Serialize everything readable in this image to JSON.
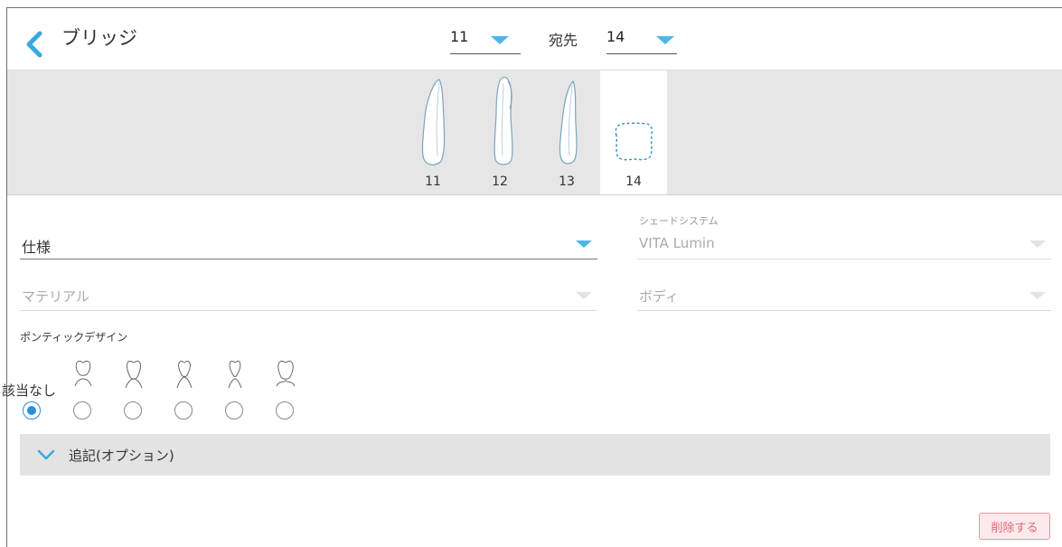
{
  "header": {
    "title": "ブリッジ",
    "from_value": "11",
    "to_label": "宛先",
    "to_value": "14"
  },
  "teeth": [
    {
      "number": "11",
      "state": "normal"
    },
    {
      "number": "12",
      "state": "normal"
    },
    {
      "number": "13",
      "state": "normal"
    },
    {
      "number": "14",
      "state": "selected-missing"
    }
  ],
  "form": {
    "spec_value": "仕様",
    "shade_system_label": "シェードシステム",
    "shade_system_value": "VITA Lumin",
    "material_placeholder": "マテリアル",
    "body_placeholder": "ボディ"
  },
  "pontic": {
    "label": "ポンティックデザイン",
    "none_label": "該当なし",
    "options": [
      {
        "icon": "no-pontic",
        "checked": true
      },
      {
        "icon": "pontic-design-1-icon",
        "checked": false
      },
      {
        "icon": "pontic-design-2-icon",
        "checked": false
      },
      {
        "icon": "pontic-design-3-icon",
        "checked": false
      },
      {
        "icon": "pontic-design-4-icon",
        "checked": false
      },
      {
        "icon": "pontic-design-5-icon",
        "checked": false
      }
    ]
  },
  "notes": {
    "label": "追記(オプション)"
  },
  "actions": {
    "delete_label": "削除する"
  },
  "colors": {
    "accent": "#4db6e8",
    "radio": "#2a8fd8",
    "delete": "#e06b78"
  }
}
